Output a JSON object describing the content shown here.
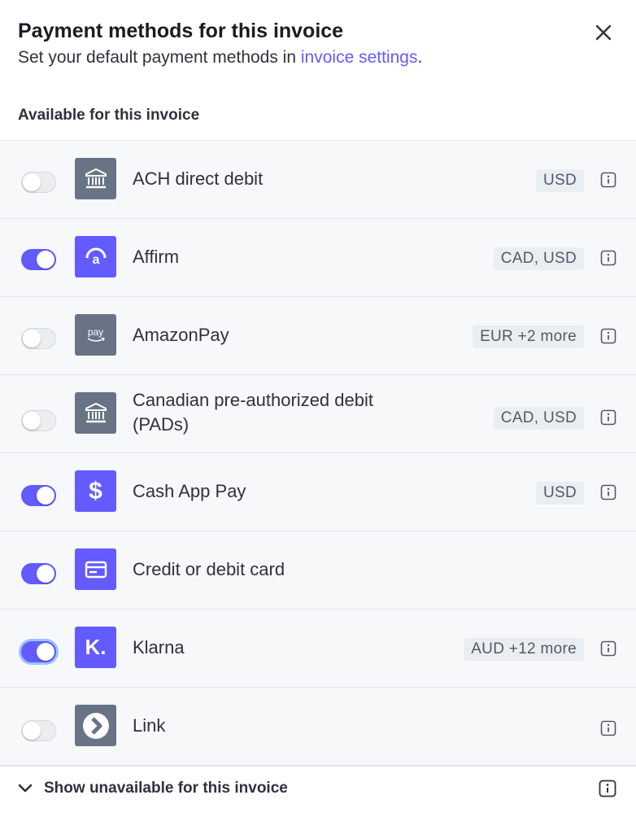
{
  "header": {
    "title": "Payment methods for this invoice",
    "subtitle_prefix": "Set your default payment methods in ",
    "subtitle_link": "invoice settings",
    "subtitle_suffix": "."
  },
  "section_label": "Available for this invoice",
  "colors": {
    "accent": "#635bff",
    "logo_gray": "#687385",
    "row_bg": "#f6f8fa"
  },
  "methods": [
    {
      "name": "ACH direct debit",
      "enabled": false,
      "currencies": "USD",
      "icon": "bank-icon"
    },
    {
      "name": "Affirm",
      "enabled": true,
      "currencies": "CAD, USD",
      "icon": "affirm-icon"
    },
    {
      "name": "AmazonPay",
      "enabled": false,
      "currencies": "EUR +2 more",
      "icon": "amazon-pay-icon",
      "icon_text": "pay"
    },
    {
      "name_line1": "Canadian pre-authorized debit",
      "name_line2": "(PADs)",
      "enabled": false,
      "currencies": "CAD, USD",
      "icon": "bank-icon"
    },
    {
      "name": "Cash App Pay",
      "enabled": true,
      "currencies": "USD",
      "icon": "dollar-icon",
      "icon_text": "$"
    },
    {
      "name": "Credit or debit card",
      "enabled": true,
      "currencies": "",
      "icon": "card-icon"
    },
    {
      "name": "Klarna",
      "enabled": true,
      "focused": true,
      "currencies": "AUD +12 more",
      "icon": "klarna-icon",
      "icon_text": "K."
    },
    {
      "name": "Link",
      "enabled": false,
      "currencies": "",
      "icon": "link-chevron-icon"
    }
  ],
  "footer": {
    "show_label": "Show unavailable for this invoice"
  }
}
